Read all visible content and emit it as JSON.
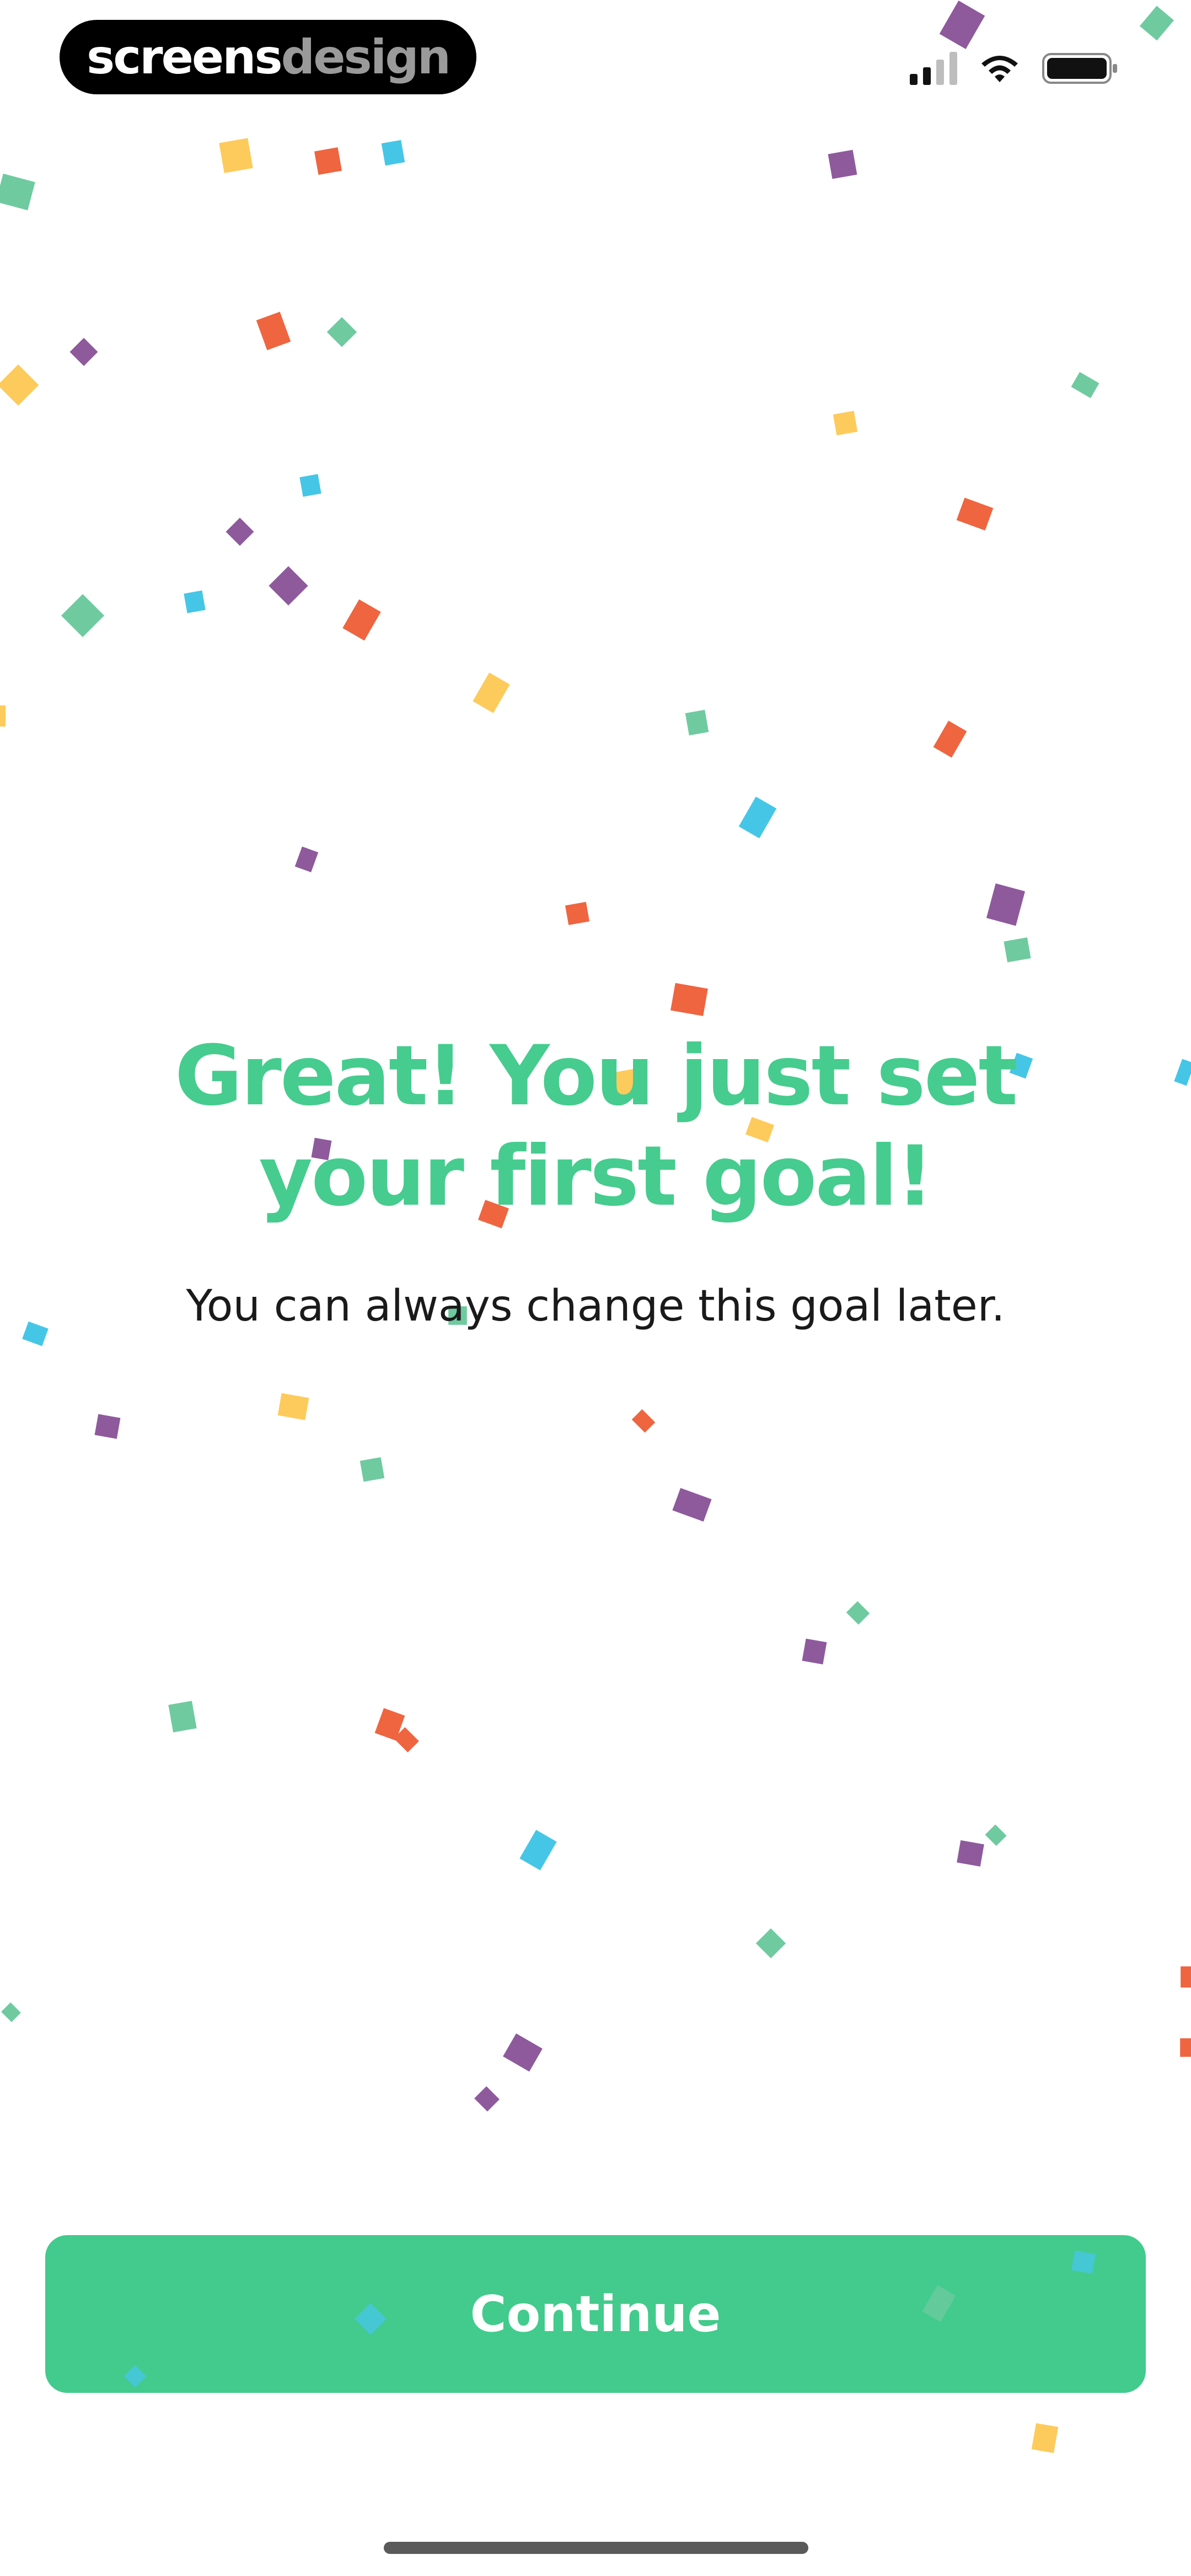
{
  "watermark": {
    "part1": "screens",
    "part2": "design"
  },
  "status_bar": {
    "signal_icon": "cellular-signal-icon",
    "wifi_icon": "wifi-icon",
    "battery_icon": "battery-icon"
  },
  "main": {
    "headline_line1": "Great! You just set",
    "headline_line2": "your first goal!",
    "subtext": "You can always change this goal later."
  },
  "actions": {
    "continue_label": "Continue"
  },
  "colors": {
    "accent_green": "#42cb8c",
    "confetti_purple": "#8e5a9c",
    "confetti_red": "#ee6540",
    "confetti_yellow": "#fdcb5c",
    "confetti_blue": "#46c6e6",
    "confetti_teal": "#6fcaa0"
  }
}
